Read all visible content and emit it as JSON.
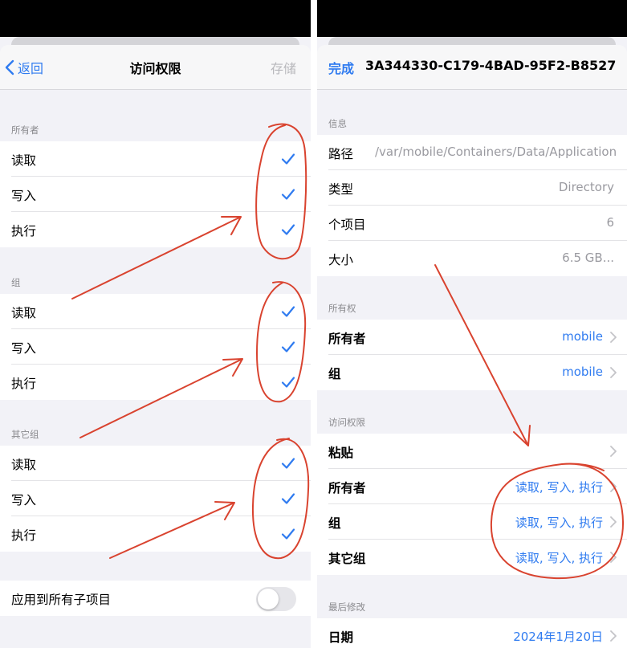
{
  "left": {
    "nav": {
      "back_label": "返回",
      "title": "访问权限",
      "save_label": "存储"
    },
    "sections": [
      {
        "label": "所有者",
        "rows": [
          {
            "label": "读取"
          },
          {
            "label": "写入"
          },
          {
            "label": "执行"
          }
        ]
      },
      {
        "label": "组",
        "rows": [
          {
            "label": "读取"
          },
          {
            "label": "写入"
          },
          {
            "label": "执行"
          }
        ]
      },
      {
        "label": "其它组",
        "rows": [
          {
            "label": "读取"
          },
          {
            "label": "写入"
          },
          {
            "label": "执行"
          }
        ]
      }
    ],
    "apply": {
      "label": "应用到所有子项目",
      "enabled": false
    }
  },
  "right": {
    "nav": {
      "done_label": "完成",
      "title": "3A344330-C179-4BAD-95F2-B8527..."
    },
    "info": {
      "label": "信息",
      "rows": [
        {
          "label": "路径",
          "value": "/var/mobile/Containers/Data/Application"
        },
        {
          "label": "类型",
          "value": "Directory"
        },
        {
          "label": "个项目",
          "value": "6"
        },
        {
          "label": "大小",
          "value": "6.5 GB..."
        }
      ]
    },
    "ownership": {
      "label": "所有权",
      "rows": [
        {
          "label": "所有者",
          "value": "mobile"
        },
        {
          "label": "组",
          "value": "mobile"
        }
      ]
    },
    "access": {
      "label": "访问权限",
      "rows": [
        {
          "label": "粘贴",
          "value": ""
        },
        {
          "label": "所有者",
          "value": "读取, 写入, 执行"
        },
        {
          "label": "组",
          "value": "读取, 写入, 执行"
        },
        {
          "label": "其它组",
          "value": "读取, 写入, 执行"
        }
      ]
    },
    "modified": {
      "label": "最后修改",
      "rows": [
        {
          "label": "日期",
          "value": "2024年1月20日"
        }
      ]
    }
  },
  "colors": {
    "accent": "#2f7bf0",
    "annotation": "#d9432f",
    "background": "#f2f2f7"
  },
  "icons": {
    "check": "checkmark-icon",
    "chevron": "chevron-right-icon",
    "back": "chevron-left-icon"
  }
}
